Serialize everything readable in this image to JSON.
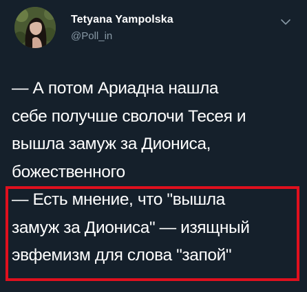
{
  "author": {
    "display_name": "Tetyana Yampolska",
    "handle": "@Poll_in",
    "avatar_icon": "profile-photo"
  },
  "tweet": {
    "lines": [
      "— А потом Ариадна нашла",
      "себе получше сволочи Тесея и",
      "вышла замуж за Диониса,",
      "божественного",
      "— Есть мнение, что \"вышла",
      "замуж за Диониса\" — изящный",
      "эвфемизм для слова \"запой\""
    ]
  },
  "menu_icon": "chevron-down-icon",
  "colors": {
    "background": "#15202b",
    "text": "#ffffff",
    "secondary_text": "#8899a6",
    "highlight_border": "#e0101e"
  }
}
